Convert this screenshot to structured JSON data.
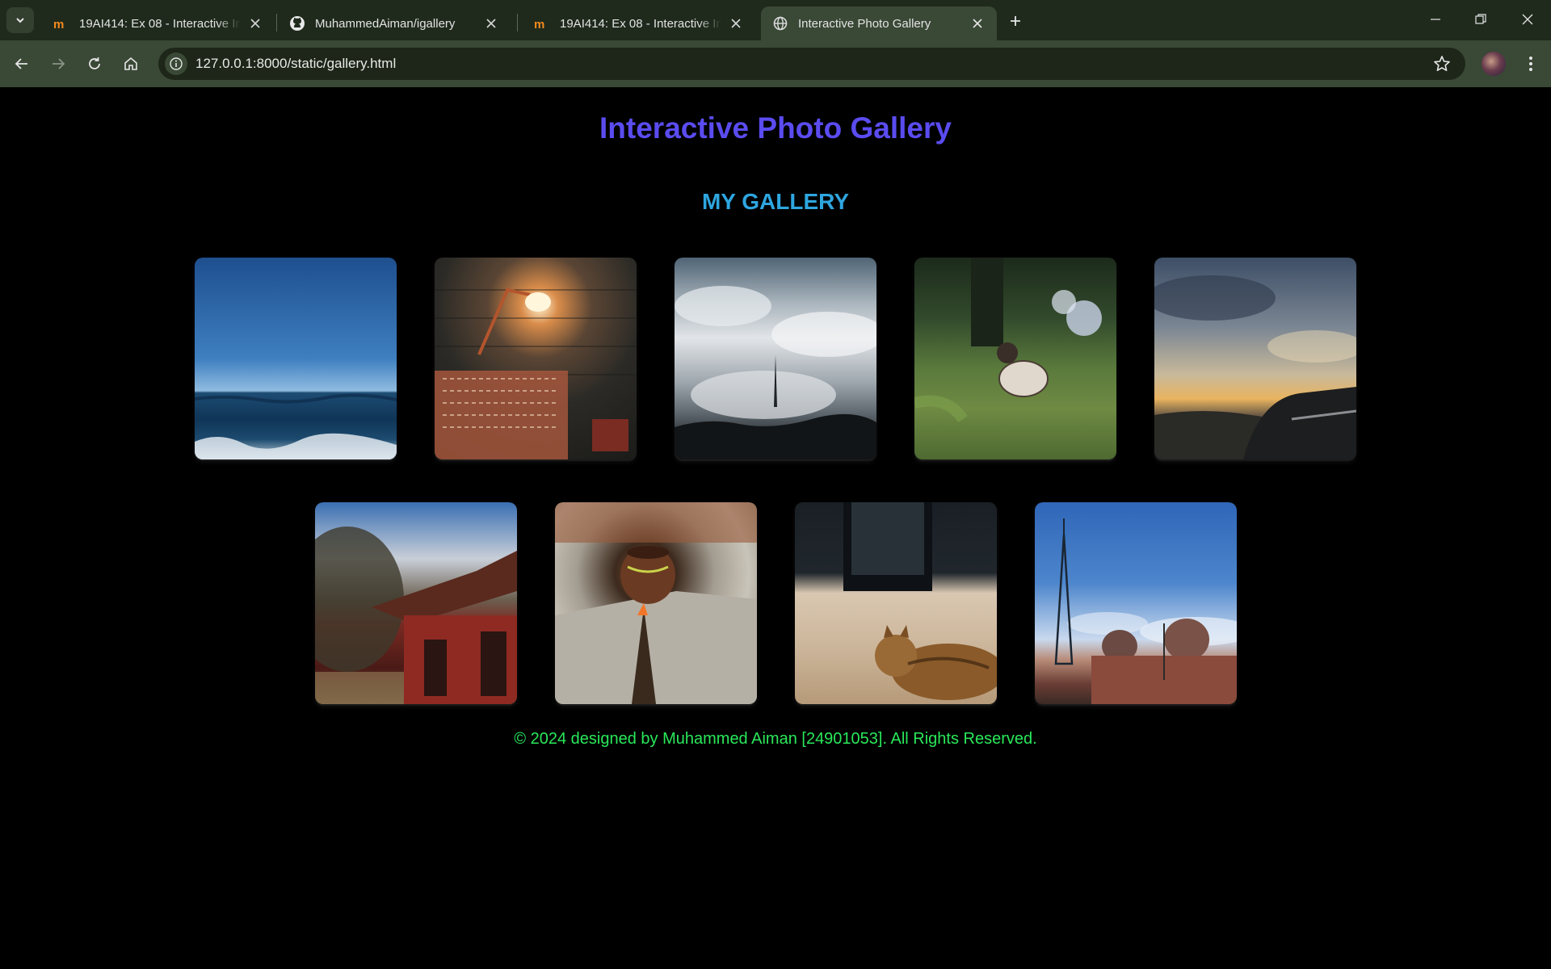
{
  "browser": {
    "tabs": [
      {
        "title": "19AI414: Ex 08 - Interactive Ima",
        "icon": "moodle-icon",
        "active": false
      },
      {
        "title": "MuhammedAiman/igallery",
        "icon": "github-icon",
        "active": false
      },
      {
        "title": "19AI414: Ex 08 - Interactive Ima",
        "icon": "moodle-icon",
        "active": false
      },
      {
        "title": "Interactive Photo Gallery",
        "icon": "globe-icon",
        "active": true
      }
    ],
    "url": "127.0.0.1:8000/static/gallery.html"
  },
  "page": {
    "title": "Interactive Photo Gallery",
    "heading": "MY GALLERY",
    "photos": [
      {
        "subject": "ocean horizon"
      },
      {
        "subject": "wall lamp"
      },
      {
        "subject": "clouds and tower"
      },
      {
        "subject": "cat on grass"
      },
      {
        "subject": "sunset with car"
      },
      {
        "subject": "red hut"
      },
      {
        "subject": "clay pot"
      },
      {
        "subject": "tabby cat"
      },
      {
        "subject": "tower and domes"
      }
    ],
    "footer": "© 2024 designed by Muhammed Aiman [24901053]. All Rights Reserved."
  },
  "colors": {
    "title": "#5a4cf0",
    "heading": "#2ea6e0",
    "footer": "#2ae85a",
    "background": "#000000",
    "chrome": "#3a4836"
  }
}
